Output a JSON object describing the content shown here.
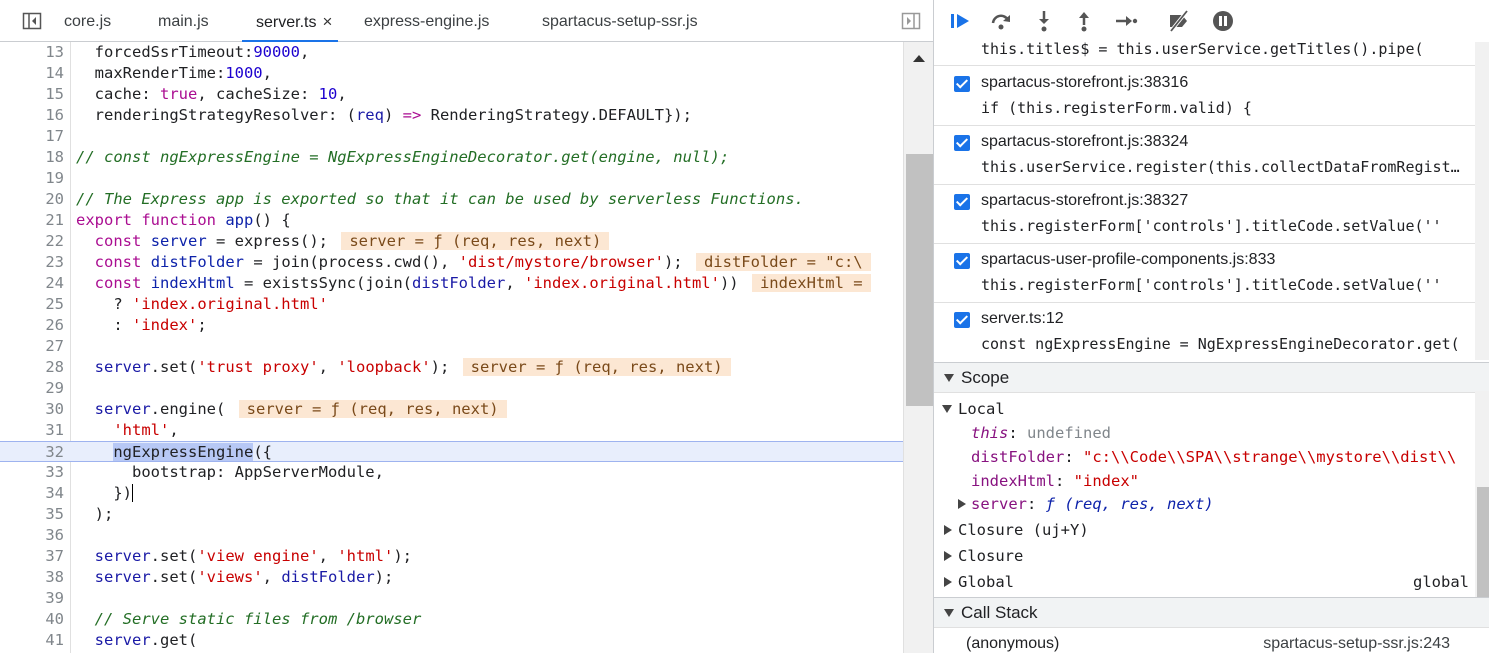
{
  "editor": {
    "tabs": [
      {
        "label": "core.js"
      },
      {
        "label": "main.js"
      },
      {
        "label": "server.ts",
        "close": "×"
      },
      {
        "label": "express-engine.js"
      },
      {
        "label": "spartacus-setup-ssr.js"
      }
    ],
    "lines": [
      {
        "n": "13"
      },
      {
        "n": "14"
      },
      {
        "n": "15"
      },
      {
        "n": "16"
      },
      {
        "n": "17"
      },
      {
        "n": "18"
      },
      {
        "n": "19"
      },
      {
        "n": "20"
      },
      {
        "n": "21"
      },
      {
        "n": "22"
      },
      {
        "n": "23"
      },
      {
        "n": "24"
      },
      {
        "n": "25"
      },
      {
        "n": "26"
      },
      {
        "n": "27"
      },
      {
        "n": "28"
      },
      {
        "n": "29"
      },
      {
        "n": "30"
      },
      {
        "n": "31"
      },
      {
        "n": "32"
      },
      {
        "n": "33"
      },
      {
        "n": "34"
      },
      {
        "n": "35"
      },
      {
        "n": "36"
      },
      {
        "n": "37"
      },
      {
        "n": "38"
      },
      {
        "n": "39"
      },
      {
        "n": "40"
      },
      {
        "n": "41"
      }
    ],
    "code": {
      "l13_a": "  forcedSsrTimeout:",
      "l13_b": "90000",
      "l13_c": ",",
      "l14_a": "  maxRenderTime:",
      "l14_b": "1000",
      "l14_c": ",",
      "l15_a": "  cache: ",
      "l15_b": "true",
      "l15_c": ", cacheSize: ",
      "l15_d": "10",
      "l15_e": ",",
      "l16_a": "  renderingStrategyResolver: (",
      "l16_b": "req",
      "l16_c": ") ",
      "l16_d": "=>",
      "l16_e": " RenderingStrategy.DEFAULT});",
      "l18": "// const ngExpressEngine = NgExpressEngineDecorator.get(engine, null);",
      "l20": "// The Express app is exported so that it can be used by serverless Functions.",
      "l21_a": "export",
      "l21_b": " ",
      "l21_c": "function",
      "l21_d": " ",
      "l21_e": "app",
      "l21_f": "() {",
      "l22_a": "  ",
      "l22_b": "const",
      "l22_c": " ",
      "l22_d": "server",
      "l22_e": " = express(); ",
      "l22_inline": "server = ƒ (req, res, next)",
      "l23_a": "  ",
      "l23_b": "const",
      "l23_c": " ",
      "l23_d": "distFolder",
      "l23_e": " = join(process.cwd(), ",
      "l23_f": "'dist/mystore/browser'",
      "l23_g": "); ",
      "l23_inline": "distFolder = \"c:\\",
      "l24_a": "  ",
      "l24_b": "const",
      "l24_c": " ",
      "l24_d": "indexHtml",
      "l24_e": " = existsSync(join(",
      "l24_f": "distFolder",
      "l24_g": ", ",
      "l24_h": "'index.original.html'",
      "l24_i": ")) ",
      "l24_inline": "indexHtml =",
      "l25_a": "    ? ",
      "l25_b": "'index.original.html'",
      "l26_a": "    : ",
      "l26_b": "'index'",
      "l26_c": ";",
      "l28_a": "  ",
      "l28_b": "server",
      "l28_c": ".set(",
      "l28_d": "'trust proxy'",
      "l28_e": ", ",
      "l28_f": "'loopback'",
      "l28_g": "); ",
      "l28_inline": "server = ƒ (req, res, next)",
      "l30_a": "  ",
      "l30_b": "server",
      "l30_c": ".engine( ",
      "l30_inline": "server = ƒ (req, res, next)",
      "l31_a": "    ",
      "l31_b": "'html'",
      "l31_c": ",",
      "l32_a": "    ",
      "l32_b": "ngExpressEngine",
      "l32_c": "({",
      "l33": "      bootstrap: AppServerModule,",
      "l34_a": "    })",
      "l35": "  );",
      "l37_a": "  ",
      "l37_b": "server",
      "l37_c": ".set(",
      "l37_d": "'view engine'",
      "l37_e": ", ",
      "l37_f": "'html'",
      "l37_g": ");",
      "l38_a": "  ",
      "l38_b": "server",
      "l38_c": ".set(",
      "l38_d": "'views'",
      "l38_e": ", ",
      "l38_f": "distFolder",
      "l38_g": ");",
      "l40": "  // Serve static files from /browser",
      "l41_a": "  ",
      "l41_b": "server",
      "l41_c": ".get("
    }
  },
  "debugger": {
    "toolbar": {
      "icons": [
        "resume-icon",
        "step-over-icon",
        "step-into-icon",
        "step-out-icon",
        "step-icon",
        "deactivate-breakpoints-icon",
        "pause-on-exceptions-icon"
      ]
    },
    "breakpoints": {
      "top_fragment": "this.titles$ = this.userService.getTitles().pipe(",
      "items": [
        {
          "location": "spartacus-storefront.js:38316",
          "code": "if (this.registerForm.valid) {"
        },
        {
          "location": "spartacus-storefront.js:38324",
          "code": "this.userService.register(this.collectDataFromRegisterForm("
        },
        {
          "location": "spartacus-storefront.js:38327",
          "code": "this.registerForm['controls'].titleCode.setValue(''"
        },
        {
          "location": "spartacus-user-profile-components.js:833",
          "code": "this.registerForm['controls'].titleCode.setValue(''"
        },
        {
          "location": "server.ts:12",
          "code": "const ngExpressEngine = NgExpressEngineDecorator.get("
        }
      ]
    },
    "scope": {
      "title": "Scope",
      "local_label": "Local",
      "entries": [
        {
          "key": "this",
          "sep": ": ",
          "value": "undefined"
        },
        {
          "key": "distFolder",
          "sep": ": ",
          "value": "\"c:\\\\Code\\\\SPA\\\\strange\\\\mystore\\\\dist\\\\"
        },
        {
          "key": "indexHtml",
          "sep": ": ",
          "value": "\"index\""
        },
        {
          "key": "server",
          "sep": ": ",
          "value": "ƒ (req, res, next)"
        }
      ],
      "closure1": "Closure (uj+Y)",
      "closure2": "Closure",
      "global_label": "Global",
      "global_value": "global"
    },
    "callstack": {
      "title": "Call Stack",
      "frame_fn": "(anonymous)",
      "frame_loc": "spartacus-setup-ssr.js:243"
    }
  },
  "colors": {
    "accent": "#1a73e8",
    "inline_value_bg": "#fce7d3",
    "current_line_bg": "#e8eefc",
    "selection": "#b7c8f5"
  }
}
